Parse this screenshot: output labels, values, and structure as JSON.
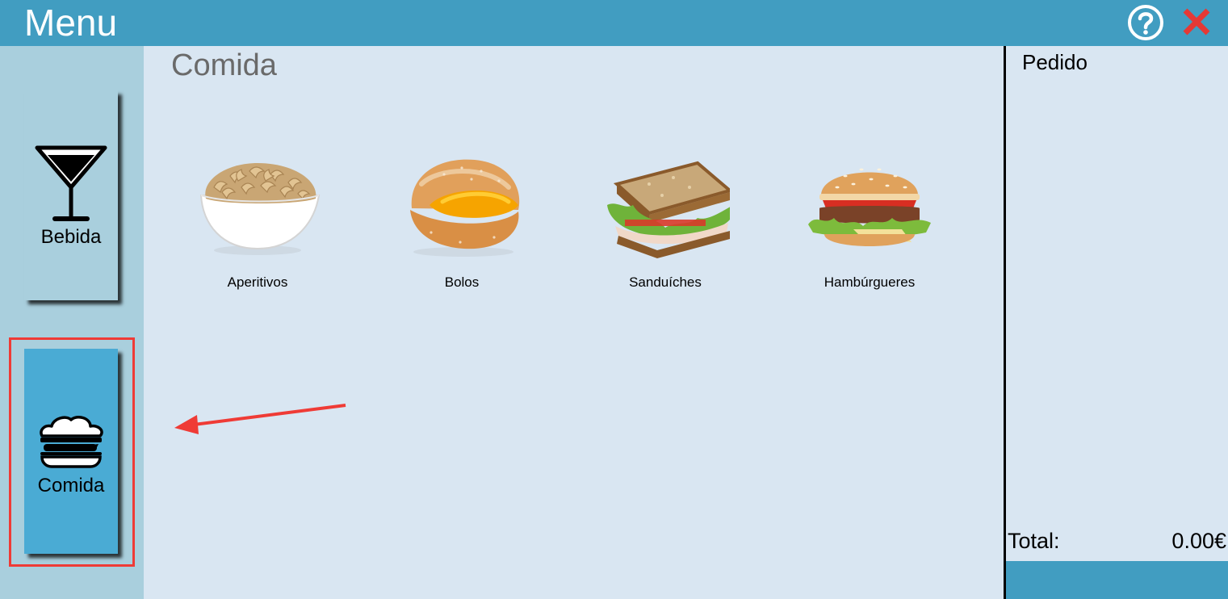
{
  "app": {
    "title": "Menu"
  },
  "header": {
    "help_icon": "question-circle-icon",
    "close_icon": "close-x-icon"
  },
  "sidebar": {
    "items": [
      {
        "label": "Bebida",
        "icon": "cocktail-glass-icon",
        "active": false
      },
      {
        "label": "Comida",
        "icon": "burger-icon",
        "active": true
      }
    ]
  },
  "main": {
    "section_title": "Comida",
    "products": [
      {
        "label": "Aperitivos",
        "image": "cashews-bowl"
      },
      {
        "label": "Bolos",
        "image": "filled-pastry"
      },
      {
        "label": "Sanduíches",
        "image": "sandwich"
      },
      {
        "label": "Hambúrgueres",
        "image": "hamburger"
      }
    ]
  },
  "order": {
    "title": "Pedido",
    "total_label": "Total:",
    "total_value": "0.00€"
  },
  "colors": {
    "header_bar": "#419dc1",
    "sidebar_bg": "#a9cfdd",
    "content_bg": "#d9e6f2",
    "active_tab": "#4aabd4",
    "annotation_red": "#ef3b36",
    "close_red": "#e53935"
  }
}
